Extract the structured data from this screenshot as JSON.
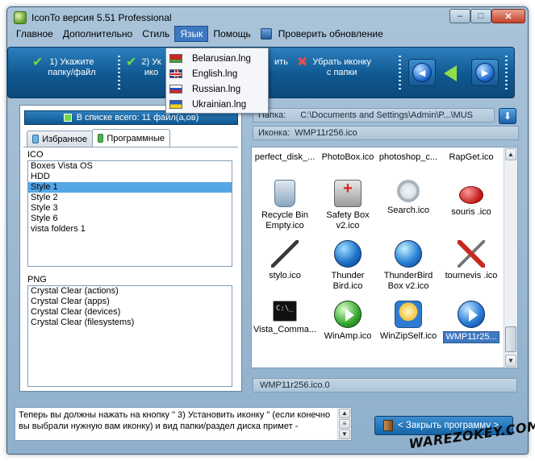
{
  "window": {
    "title": "IconTo версия 5.51 Professional"
  },
  "menu": {
    "items": [
      "Главное",
      "Дополнительно",
      "Стиль",
      "Язык",
      "Помощь"
    ],
    "update": "Проверить обновление"
  },
  "language_menu": [
    "Belarusian.lng",
    "English.lng",
    "Russian.lng",
    "Ukrainian.lng"
  ],
  "toolbar": {
    "step1": [
      "1) Укажите",
      "папку/файл"
    ],
    "step2": [
      "2) Ук",
      "ико"
    ],
    "step3": "ить",
    "remove": [
      "Убрать иконку",
      "с папки"
    ]
  },
  "left": {
    "count": "В списке всего: 11 файл(а,ов)",
    "tab_favorites": "Избранное",
    "tab_programs": "Программные",
    "ico_label": "ICO",
    "ico_items": [
      "Boxes Vista OS",
      "HDD",
      "Style 1",
      "Style 2",
      "Style 3",
      "Style 6",
      "vista folders 1"
    ],
    "ico_selected_index": 2,
    "png_label": "PNG",
    "png_items": [
      "Crystal Clear (actions)",
      "Crystal Clear (apps)",
      "Crystal Clear (devices)",
      "Crystal Clear (filesystems)"
    ]
  },
  "right": {
    "folder_label": "Папка:",
    "folder_value": "C:\\Documents and Settings\\Admin\\P...\\MUS",
    "icon_label": "Иконка:",
    "icon_value": "WMP11r256.ico",
    "top_row": [
      "perfect_disk_...",
      "PhotoBox.ico",
      "photoshop_c...",
      "RapGet.ico"
    ],
    "icons": [
      {
        "icon": "recycle-bin-icon",
        "label": [
          "Recycle Bin",
          "Empty.ico"
        ]
      },
      {
        "icon": "first-aid-box-icon",
        "label": [
          "Safety Box",
          "v2.ico"
        ]
      },
      {
        "icon": "magnifier-icon",
        "label": [
          "Search.ico"
        ]
      },
      {
        "icon": "mouse-icon",
        "label": [
          "souris .ico"
        ]
      },
      {
        "icon": "pen-icon",
        "label": [
          "stylo.ico"
        ]
      },
      {
        "icon": "globe-bird-icon",
        "label": [
          "Thunder",
          "Bird.ico"
        ]
      },
      {
        "icon": "globe-box-icon",
        "label": [
          "ThunderBird",
          "Box v2.ico"
        ]
      },
      {
        "icon": "screwdriver-icon",
        "label": [
          "tournevis .ico"
        ]
      },
      {
        "icon": "command-prompt-icon",
        "label": [
          "Vista_Comma..."
        ]
      },
      {
        "icon": "winamp-icon",
        "label": [
          "WinAmp.ico"
        ]
      },
      {
        "icon": "winzip-icon",
        "label": [
          "WinZipSelf.ico"
        ]
      },
      {
        "icon": "media-player-icon",
        "label": [
          "WMP11r25..."
        ]
      }
    ],
    "selected_icon_index": 11,
    "file_field": "WMP11r256.ico.0"
  },
  "status": {
    "text": "Теперь вы должны нажать на кнопку \" 3)  Установить иконку \" (если конечно вы выбрали нужную вам иконку) и вид папки/раздел диска примет -"
  },
  "close_button": "< Закрыть программу >",
  "watermark": "WAREZOKEY.COM"
}
